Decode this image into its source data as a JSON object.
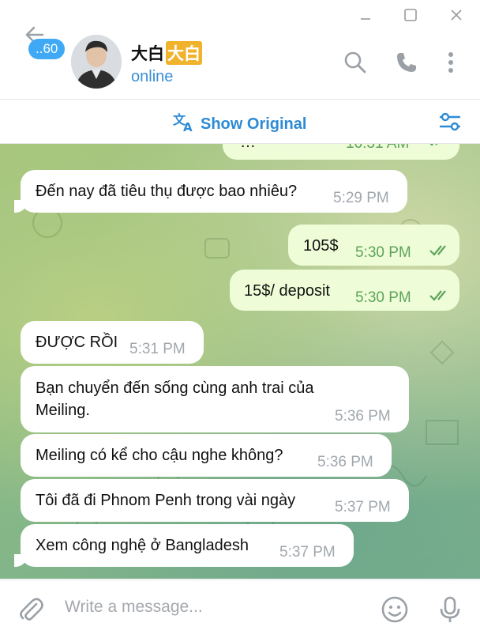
{
  "window": {
    "minimize_icon": "minimize-icon",
    "maximize_icon": "maximize-icon",
    "close_icon": "close-icon"
  },
  "header": {
    "unread_count": "..60",
    "contact_name": "大白",
    "name_emoji": "大白",
    "status": "online"
  },
  "translation_bar": {
    "label": "Show Original"
  },
  "messages": [
    {
      "direction": "out",
      "text": "…",
      "time": "10:31 AM",
      "partial": true
    },
    {
      "direction": "in",
      "text": "Đến nay đã tiêu thụ được bao nhiêu?",
      "time": "5:29 PM"
    },
    {
      "direction": "out",
      "text": "105$",
      "time": "5:30 PM"
    },
    {
      "direction": "out",
      "text": "15$/ deposit",
      "time": "5:30 PM"
    },
    {
      "direction": "in",
      "text": "ĐƯỢC RỒI",
      "time": "5:31 PM"
    },
    {
      "direction": "in",
      "text": "Bạn chuyển đến sống cùng anh trai của Meiling.",
      "time": "5:36 PM"
    },
    {
      "direction": "in",
      "text": "Meiling có kể cho cậu nghe không?",
      "time": "5:36 PM"
    },
    {
      "direction": "in",
      "text": "Tôi đã đi Phnom Penh trong vài ngày",
      "time": "5:37 PM"
    },
    {
      "direction": "in",
      "text": "Xem công nghệ ở Bangladesh",
      "time": "5:37 PM"
    }
  ],
  "composer": {
    "placeholder": "Write a message..."
  },
  "colors": {
    "accent": "#3a8fd6",
    "outgoing_bubble": "#eefdd7",
    "incoming_bubble": "#ffffff",
    "read_check": "#5ea35b"
  }
}
